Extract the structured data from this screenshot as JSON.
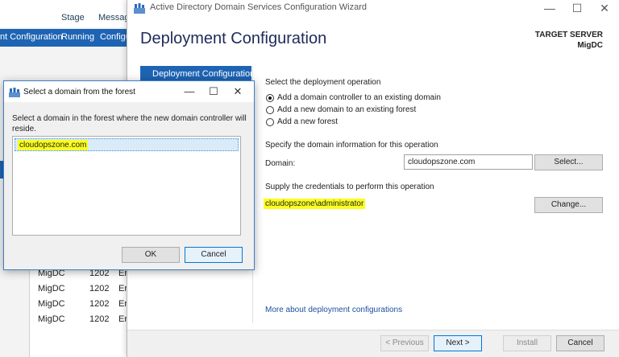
{
  "background": {
    "tabs": [
      "Stage",
      "Messag"
    ],
    "bar_items": [
      "nt Configuration",
      "Running",
      "Configu"
    ],
    "rows": [
      {
        "server": "MigDC",
        "id": "1202",
        "sev": "Erro"
      },
      {
        "server": "MigDC",
        "id": "1202",
        "sev": "Erro"
      },
      {
        "server": "MigDC",
        "id": "1202",
        "sev": "Erro"
      },
      {
        "server": "MigDC",
        "id": "1202",
        "sev": "Erro"
      }
    ]
  },
  "wizard": {
    "title": "Active Directory Domain Services Configuration Wizard",
    "heading": "Deployment Configuration",
    "target_label": "TARGET SERVER",
    "target_value": "MigDC",
    "nav_active": "Deployment Configuration",
    "operation_label": "Select the deployment operation",
    "options": [
      {
        "label": "Add a domain controller to an existing domain",
        "selected": true
      },
      {
        "label": "Add a new domain to an existing forest",
        "selected": false
      },
      {
        "label": "Add a new forest",
        "selected": false
      }
    ],
    "domain_info_label": "Specify the domain information for this operation",
    "domain_label": "Domain:",
    "domain_value": "cloudopszone.com",
    "select_button": "Select...",
    "credentials_label": "Supply the credentials to perform this operation",
    "credentials_value": "cloudopszone\\administrator",
    "change_button": "Change...",
    "more_link": "More about deployment configurations",
    "footer": {
      "previous": "< Previous",
      "next": "Next >",
      "install": "Install",
      "cancel": "Cancel"
    },
    "controls": {
      "minimize": "—",
      "maximize": "☐",
      "close": "✕"
    }
  },
  "dialog": {
    "title": "Select a domain from the forest",
    "description": "Select a domain in the forest where the new domain controller will reside.",
    "domains": [
      "cloudopszone.com"
    ],
    "ok": "OK",
    "cancel": "Cancel",
    "controls": {
      "minimize": "—",
      "maximize": "☐",
      "close": "✕"
    }
  },
  "colors": {
    "accent": "#1e64b4",
    "highlight": "#fbff20",
    "heading": "#1e2a5a",
    "link": "#1e50a0"
  }
}
